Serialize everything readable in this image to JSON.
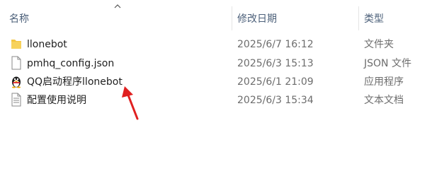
{
  "header": {
    "name_label": "名称",
    "date_label": "修改日期",
    "type_label": "类型"
  },
  "files": [
    {
      "name": "llonebot",
      "date": "2025/6/7 16:12",
      "type": "文件夹",
      "icon": "folder-icon"
    },
    {
      "name": "pmhq_config.json",
      "date": "2025/6/3 15:13",
      "type": "JSON 文件",
      "icon": "file-icon"
    },
    {
      "name": "QQ启动程序llonebot",
      "date": "2025/6/1 21:09",
      "type": "应用程序",
      "icon": "penguin-app-icon"
    },
    {
      "name": "配置使用说明",
      "date": "2025/6/3 15:34",
      "type": "文本文档",
      "icon": "text-document-icon"
    }
  ],
  "colors": {
    "header_text": "#4c607a",
    "folder": "#f4c542",
    "annotation_arrow": "#e02020"
  }
}
